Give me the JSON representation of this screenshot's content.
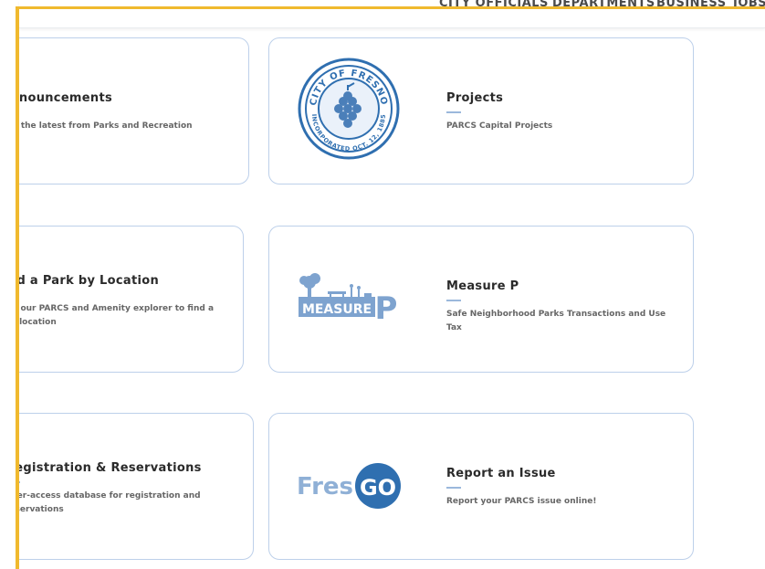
{
  "nav": {
    "items": [
      "CITY OFFICIALS",
      "DEPARTMENTS",
      "BUSINESS",
      "JOBS"
    ]
  },
  "cards": [
    {
      "title": "Announcements",
      "desc": "See the latest from Parks and Recreation"
    },
    {
      "title": "Projects",
      "desc": "PARCS Capital Projects",
      "logo_text": "CITY OF FRESNO",
      "logo_subtext": "INCORPORATED OCT. 12, 1885"
    },
    {
      "title": "Find a Park by Location",
      "desc": "View our PARCS and Amenity explorer to find a park location"
    },
    {
      "title": "Measure P",
      "desc": "Safe Neighborhood Parks Transactions and Use Tax",
      "logo_text": "MEASURE",
      "logo_letter": "P"
    },
    {
      "title": "Registration & Reservations",
      "desc": "User-access database for registration and reservations"
    },
    {
      "title": "Report an Issue",
      "desc": "Report your PARCS issue online!",
      "logo_text": "Fres",
      "logo_text2": "GO"
    }
  ],
  "colors": {
    "frame": "#f0b92e",
    "card_border": "#bdd0ea",
    "brand_blue": "#2f6fb0",
    "fresgo_blue": "#4b7fb9"
  }
}
